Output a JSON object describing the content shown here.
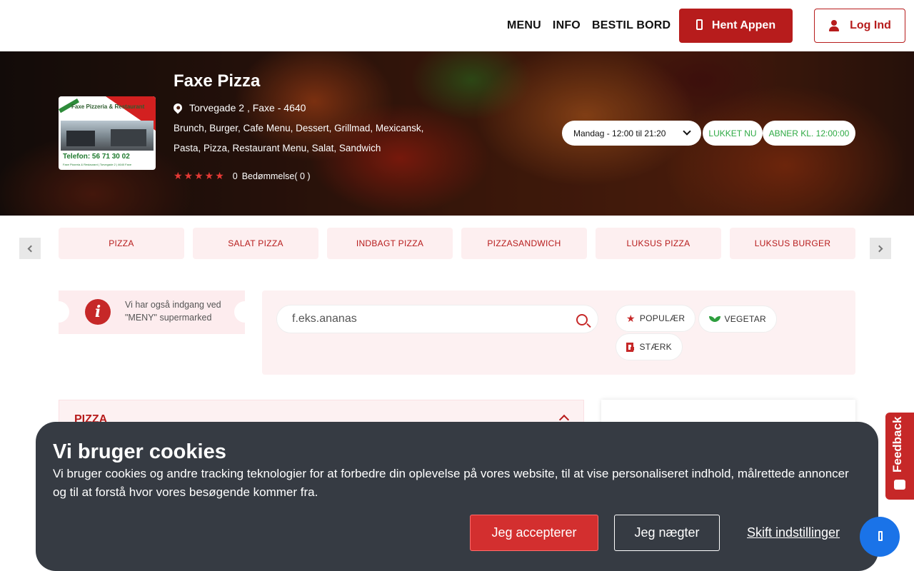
{
  "header": {
    "nav": [
      "MENU",
      "INFO",
      "BESTIL BORD"
    ],
    "app_button": "Hent Appen",
    "login_button": "Log Ind",
    "brand_color": "#b71c1c"
  },
  "restaurant": {
    "name": "Faxe Pizza",
    "address": "Torvegade 2 , Faxe - 4640",
    "cuisines": "Brunch, Burger, Cafe Menu, Dessert, Grillmad, Mexicansk, Pasta, Pizza, Restaurant Menu, Salat, Sandwich",
    "rating_value": "0",
    "rating_label": "Bedømmelse( 0 )",
    "stars": "★★★★★",
    "logo": {
      "title": "Faxe Pizzeria & Restaurant",
      "phone": "Telefon: 56 71 30 02",
      "small": "Faxe Pizzeria & Restaurant | Torvegade 2 | 4640 Faxe"
    }
  },
  "hours": {
    "selected": "Mandag - 12:00 til 21:20",
    "status": "LUKKET NU",
    "opens": "ABNER KL. 12:00:00",
    "status_color": "#2eaa44"
  },
  "categories": [
    "PIZZA",
    "SALAT PIZZA",
    "INDBAGT PIZZA",
    "PIZZASANDWICH",
    "LUKSUS PIZZA",
    "LUKSUS BURGER"
  ],
  "notice": {
    "text": "Vi har også indgang ved \"MENY\" supermarked"
  },
  "search": {
    "placeholder": "f.eks.ananas"
  },
  "filters": {
    "popular": "POPULÆR",
    "vegetarian": "VEGETAR",
    "strong": "STÆRK"
  },
  "menu_section": {
    "title": "PIZZA"
  },
  "feedback": {
    "label": "Feedback"
  },
  "cookie": {
    "title": "Vi bruger cookies",
    "text": "Vi bruger cookies og andre tracking teknologier for at forbedre din oplevelse på vores website, til at vise personaliseret indhold, målrettede annoncer og til at forstå hvor vores besøgende kommer fra.",
    "accept": "Jeg accepterer",
    "deny": "Jeg nægter",
    "settings": "Skift indstillinger"
  }
}
